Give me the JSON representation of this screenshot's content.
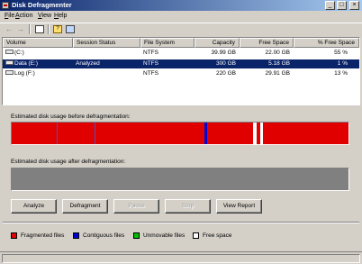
{
  "window": {
    "title": "Disk Defragmenter"
  },
  "menu": {
    "items": [
      "File",
      "Action",
      "View",
      "Help"
    ]
  },
  "toolbar": {
    "icons": [
      "back-icon",
      "forward-icon",
      "properties-icon",
      "help-icon",
      "snapin-icon"
    ]
  },
  "volumes": {
    "columns": [
      "Volume",
      "Session Status",
      "File System",
      "Capacity",
      "Free Space",
      "% Free Space"
    ],
    "rows": [
      {
        "volume": "(C:)",
        "status": "",
        "fs": "NTFS",
        "capacity": "39.99 GB",
        "free": "22.00 GB",
        "pct": "55 %"
      },
      {
        "volume": "Data (E:)",
        "status": "Analyzed",
        "fs": "NTFS",
        "capacity": "300 GB",
        "free": "5.18 GB",
        "pct": "1 %"
      },
      {
        "volume": "Log (F:)",
        "status": "",
        "fs": "NTFS",
        "capacity": "220 GB",
        "free": "29.91 GB",
        "pct": "13 %"
      }
    ],
    "selected_index": 1
  },
  "analysis": {
    "before_label": "Estimated disk usage before defragmentation:",
    "after_label": "Estimated disk usage after defragmentation:"
  },
  "buttons": {
    "analyze": "Analyze",
    "defragment": "Defragment",
    "pause": "Pause",
    "stop": "Stop",
    "view_report": "View Report"
  },
  "legend": {
    "fragmented": "Fragmented files",
    "contiguous": "Contiguous files",
    "unmovable": "Unmovable files",
    "free": "Free space"
  },
  "colors": {
    "fragmented": "#e00000",
    "contiguous": "#0000d0",
    "unmovable": "#00c000",
    "free": "#ffffff",
    "selection": "#0a246a"
  }
}
